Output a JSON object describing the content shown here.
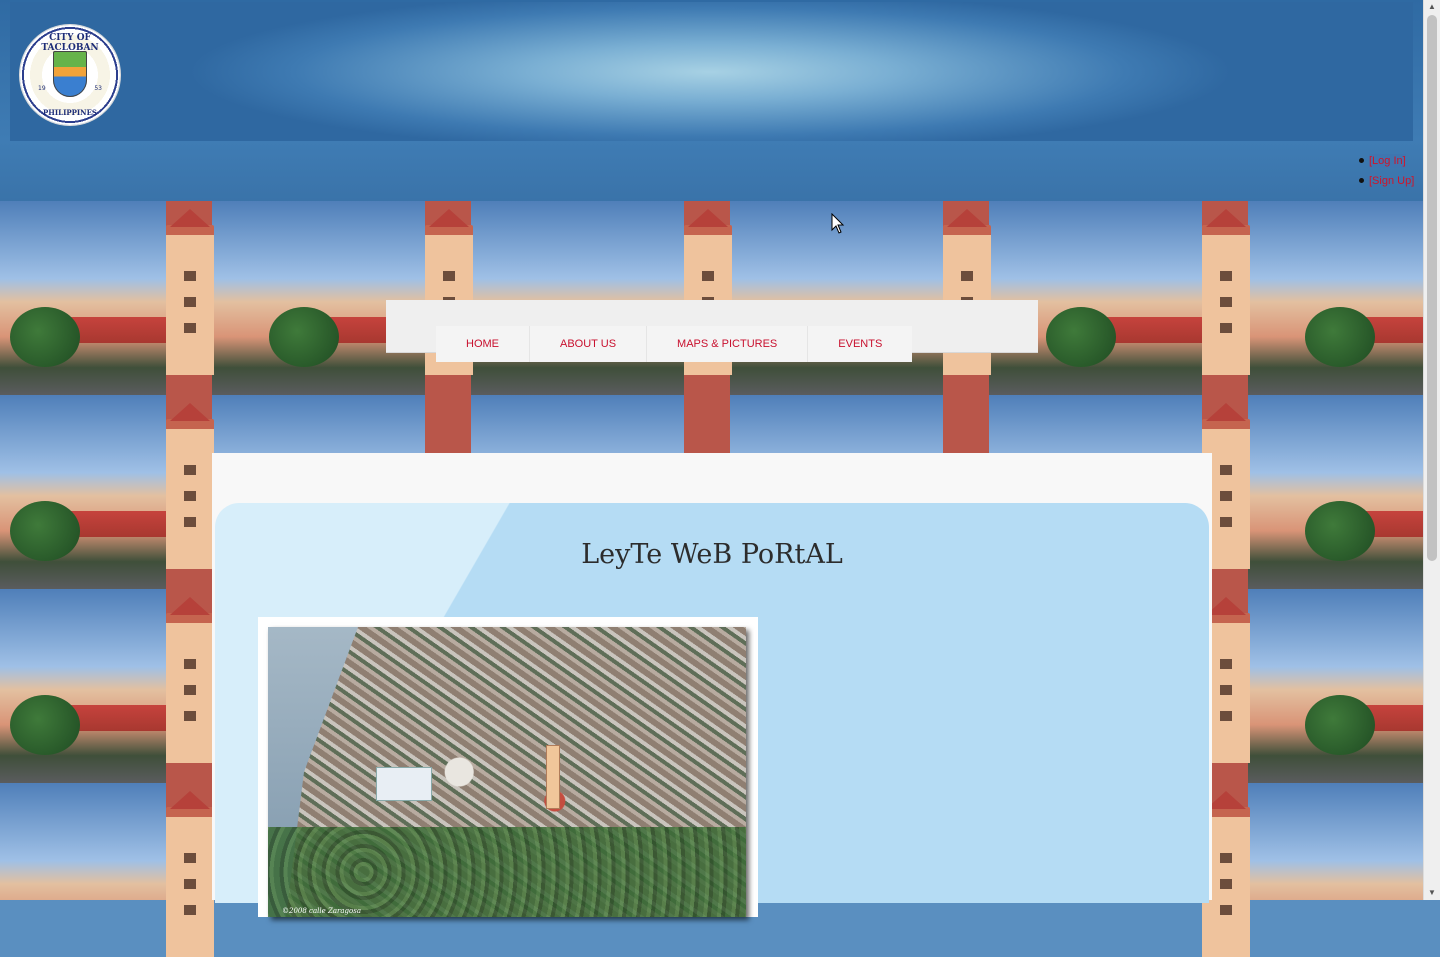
{
  "header": {
    "logo": {
      "ring_text": "CITY OF TACLOBAN",
      "bottom_text": "PHILIPPINES",
      "year_left": "19",
      "year_right": "53"
    },
    "auth": {
      "login": "[Log In]",
      "signup": "[Sign Up]"
    }
  },
  "nav": {
    "items": [
      {
        "label": "HOME"
      },
      {
        "label": "ABOUT US"
      },
      {
        "label": "MAPS & PICTURES"
      },
      {
        "label": "EVENTS"
      }
    ]
  },
  "main": {
    "title": "LeyTe WeB PoRtAL",
    "photo_credit": "©2008 calle Zaragosa"
  },
  "colors": {
    "link_red": "#c8102e",
    "header_blue": "#3f7cb4",
    "panel_blue": "#b5dcf4"
  },
  "icons": {
    "scroll_up": "▲",
    "scroll_down": "▼"
  }
}
